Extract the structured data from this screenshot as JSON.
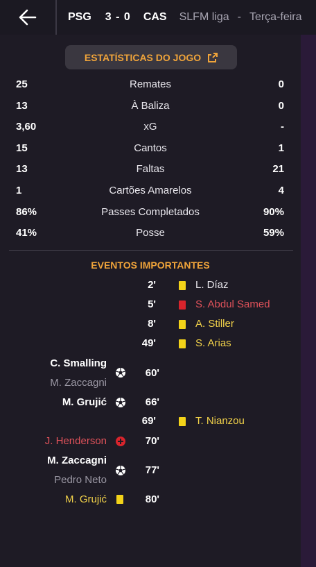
{
  "header": {
    "home_team": "PSG",
    "score": "3 - 0",
    "away_team": "CAS",
    "league": "SLFM liga",
    "separator": "-",
    "date": "Terça-feira"
  },
  "stats_button": {
    "label": "ESTATÍSTICAS DO JOGO"
  },
  "stats": [
    {
      "home": "25",
      "label": "Remates",
      "away": "0"
    },
    {
      "home": "13",
      "label": "À Baliza",
      "away": "0"
    },
    {
      "home": "3,60",
      "label": "xG",
      "away": "-"
    },
    {
      "home": "15",
      "label": "Cantos",
      "away": "1"
    },
    {
      "home": "13",
      "label": "Faltas",
      "away": "21"
    },
    {
      "home": "1",
      "label": "Cartões Amarelos",
      "away": "4"
    },
    {
      "home": "86%",
      "label": "Passes Completados",
      "away": "90%"
    },
    {
      "home": "41%",
      "label": "Posse",
      "away": "59%"
    }
  ],
  "events_title": "EVENTOS IMPORTANTES",
  "events": [
    {
      "minute": "2'",
      "player": "L. Díaz"
    },
    {
      "minute": "5'",
      "player": "S. Abdul Samed"
    },
    {
      "minute": "8'",
      "player": "A. Stiller"
    },
    {
      "minute": "49'",
      "player": "S. Arias"
    },
    {
      "minute": "60'",
      "player": "C. Smalling",
      "assist": "M. Zaccagni"
    },
    {
      "minute": "66'",
      "player": "M. Grujić"
    },
    {
      "minute": "69'",
      "player": "T. Nianzou"
    },
    {
      "minute": "70'",
      "player": "J. Henderson"
    },
    {
      "minute": "77'",
      "player": "M. Zaccagni",
      "assist": "Pedro Neto"
    },
    {
      "minute": "80'",
      "player": "M. Grujić"
    }
  ]
}
